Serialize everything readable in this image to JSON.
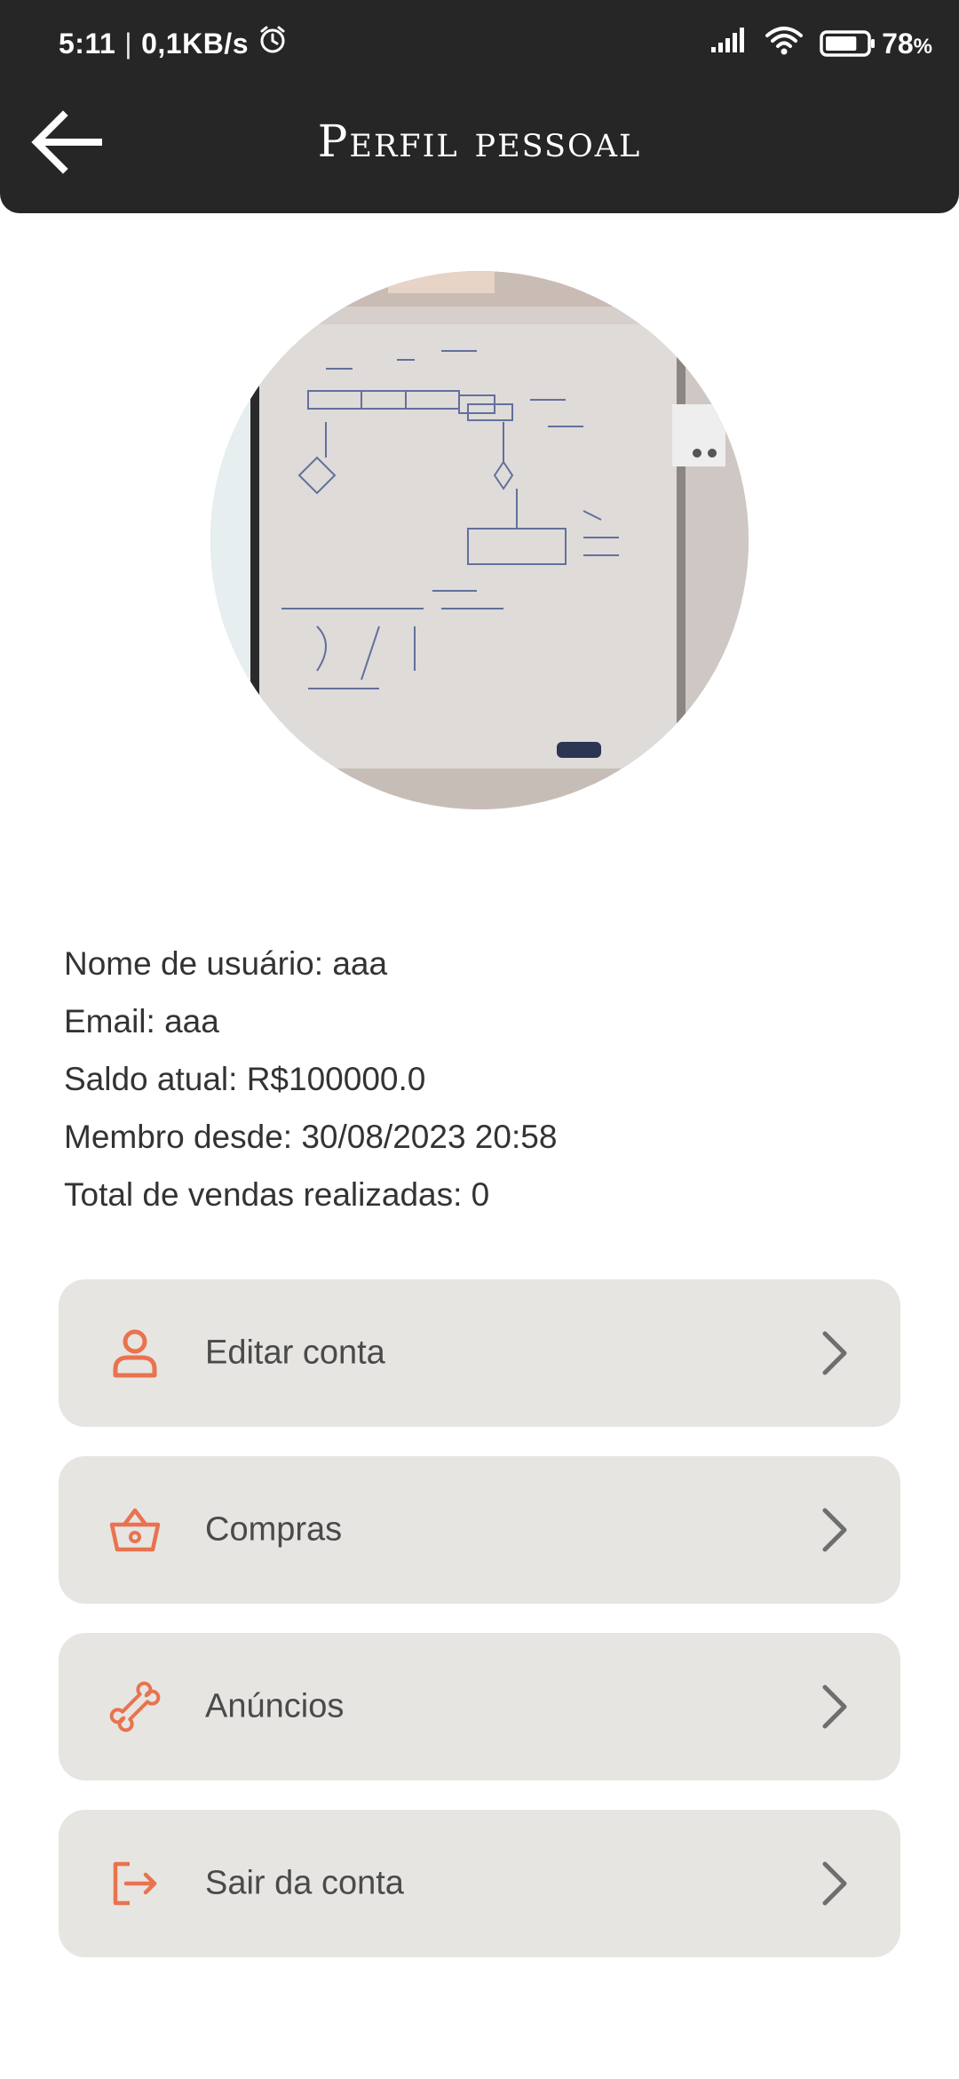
{
  "status_bar": {
    "time": "5:11",
    "separator": "|",
    "network_speed": "0,1KB/s",
    "battery_percent": "78",
    "battery_suffix": "%",
    "battery_level": 0.78
  },
  "header": {
    "title": "Perfil pessoal"
  },
  "profile": {
    "fields": [
      "Nome de usuário: aaa",
      "Email: aaa",
      "Saldo atual: R$100000.0",
      "Membro desde: 30/08/2023 20:58",
      "Total de vendas realizadas: 0"
    ]
  },
  "menu": {
    "items": [
      {
        "label": "Editar conta",
        "icon": "person-icon"
      },
      {
        "label": "Compras",
        "icon": "basket-icon"
      },
      {
        "label": "Anúncios",
        "icon": "bone-icon"
      },
      {
        "label": "Sair da conta",
        "icon": "logout-icon"
      }
    ]
  },
  "colors": {
    "header_bg": "#262626",
    "accent": "#e8734e",
    "card_bg": "#e7e5e2",
    "text": "#333333"
  }
}
